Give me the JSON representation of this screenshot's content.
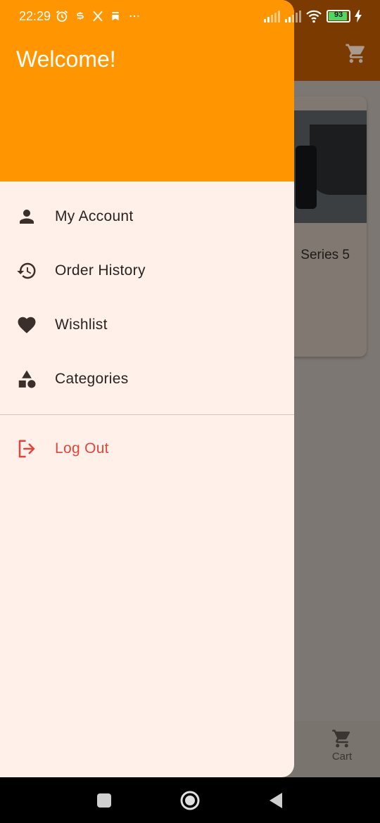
{
  "status_bar": {
    "time": "22:29",
    "battery": "93",
    "icons_left": [
      "alarm-icon",
      "s-app-icon",
      "x-app-icon",
      "bookmark-icon",
      "more-dots-icon"
    ],
    "icons_right": [
      "signal-icon",
      "signal-icon",
      "wifi-icon",
      "battery-icon",
      "charging-icon"
    ]
  },
  "background_app": {
    "product_title_partial": "Series 5",
    "bottom_nav": {
      "cart_label": "Cart"
    }
  },
  "drawer": {
    "header_title": "Welcome!",
    "header_color": "#ff9500",
    "items": [
      {
        "label": "My Account",
        "icon": "person-icon"
      },
      {
        "label": "Order History",
        "icon": "history-icon"
      },
      {
        "label": "Wishlist",
        "icon": "heart-icon"
      },
      {
        "label": "Categories",
        "icon": "categories-icon"
      }
    ],
    "logout": {
      "label": "Log Out",
      "icon": "logout-icon",
      "color": "#e2463a"
    }
  }
}
